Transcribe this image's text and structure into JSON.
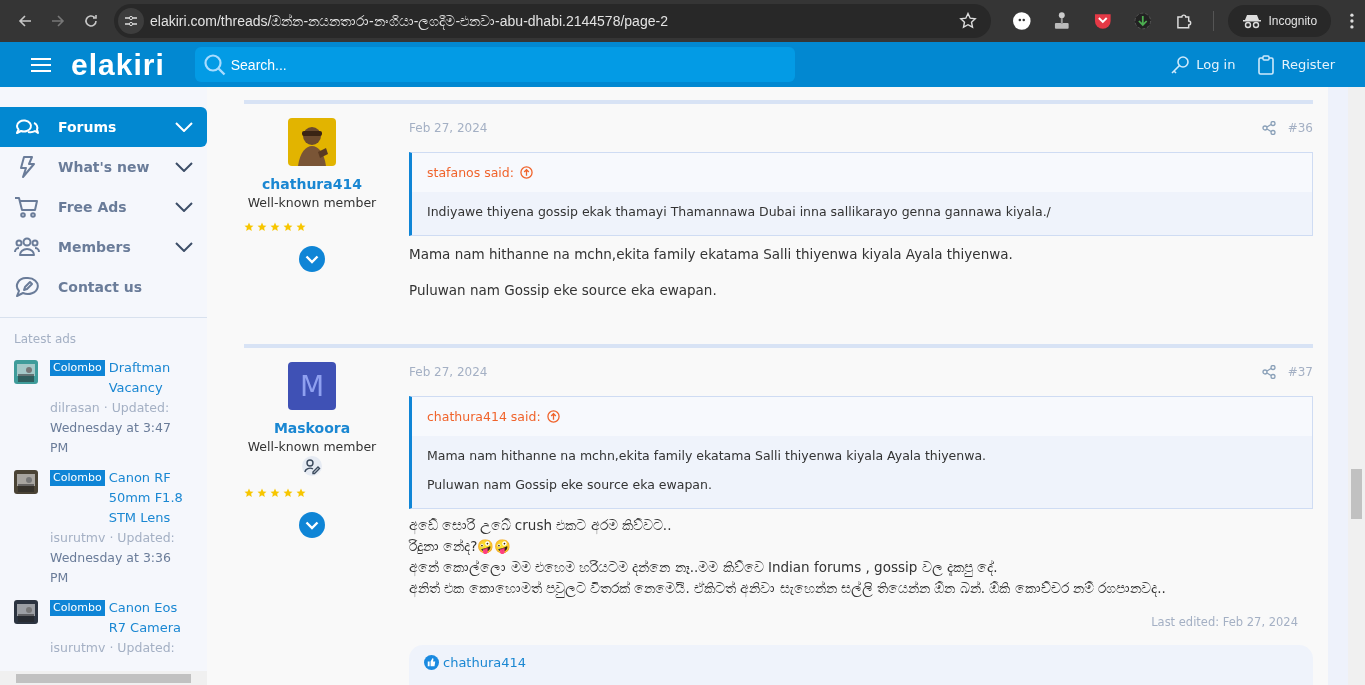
{
  "browser": {
    "url": "elakiri.com/threads/ඔන්න-නයනතාරා-නංගියා-ලගදීම-එනවා-abu-dhabi.2144578/page-2",
    "profile": "Incognito"
  },
  "header": {
    "logo": "elakiri",
    "search": {
      "placeholder": "Search..."
    },
    "login": "Log in",
    "register": "Register"
  },
  "sidebar": {
    "items": [
      {
        "label": "Forums",
        "selected": true,
        "expandable": true
      },
      {
        "label": "What's new",
        "selected": false,
        "expandable": true
      },
      {
        "label": "Free Ads",
        "selected": false,
        "expandable": true
      },
      {
        "label": "Members",
        "selected": false,
        "expandable": true
      },
      {
        "label": "Contact us",
        "selected": false,
        "expandable": false
      }
    ],
    "latest_ads": {
      "heading": "Latest ads",
      "ads": [
        {
          "location": "Colombo",
          "title": "Draftman Vacancy",
          "meta": "dilrasan · Updated:",
          "date": "Wednesday at 3:47 PM"
        },
        {
          "location": "Colombo",
          "title": "Canon RF 50mm F1.8 STM Lens",
          "meta": "isurutmv · Updated:",
          "date": "Wednesday at 3:36 PM"
        },
        {
          "location": "Colombo",
          "title": "Canon Eos R7 Camera",
          "meta": "isurutmv · Updated:"
        }
      ]
    }
  },
  "posts": [
    {
      "user": "chathura414",
      "role": "Well-known member",
      "staff_icon": false,
      "stars": 5,
      "date": "Feb 27, 2024",
      "number": "#36",
      "quote": {
        "author": "stafanos said:",
        "lines": [
          "Indiyawe thiyena gossip ekak thamayi Thamannawa Dubai inna sallikarayo genna gannawa kiyala./"
        ]
      },
      "body": {
        "kind": "paragraphs",
        "lines": [
          "Mama nam hithanne na mchn,ekita family ekatama Salli thiyenwa kiyala Ayala thiyenwa.",
          "Puluwan nam Gossip eke source eka ewapan."
        ]
      }
    },
    {
      "user": "Maskoora",
      "role": "Well-known member",
      "avatar": {
        "kind": "letter",
        "letter": "M"
      },
      "staff_icon": true,
      "stars": 5,
      "date": "Feb 27, 2024",
      "number": "#37",
      "quote": {
        "author": "chathura414 said:",
        "lines": [
          "Mama nam hithanne na mchn,ekita family ekatama Salli thiyenwa kiyala Ayala thiyenwa.",
          "Puluwan nam Gossip eke source eka ewapan."
        ]
      },
      "body": {
        "kind": "lines",
        "lines": [
          "අඩේ සොරි උබේ crush එකට අරම කිව්වට..",
          "රිදුනා නේද?🤪🤪",
          "අනේ කොල්ලො මම එහෙම හරියටම දන්නෙ නෑ..මම කිව්වෙ Indian forums , gossip වල දැකපු දේ.",
          "අනිත් එක කොහොමත් පවුලට විතරක් නෙමෙයි. ඒකිටත් අනිවා සැහෙන්න සල්ලි තියෙන්න ඕන බන්. ඕකි කොච්චර නම් රගපානවද.."
        ]
      },
      "last_edited": "Last edited: Feb 27, 2024",
      "reactions": "chathura414"
    }
  ]
}
